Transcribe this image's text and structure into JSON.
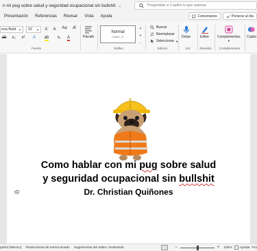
{
  "title_bar": {
    "doc_title": "n mi pug sobre salud y seguridad ocupacional sin bullshit",
    "search_placeholder": "Pregúntale a Copilot lo que quieras"
  },
  "tabs": [
    "Presentación",
    "Referencias",
    "Revisar",
    "Vista",
    "Ayuda"
  ],
  "tab_actions": {
    "comments": "Comentarios",
    "catch_up": "Ponerse al día"
  },
  "ribbon": {
    "font_name": "ova Bold",
    "font_size": "22",
    "groups": {
      "font": "Fuente",
      "paragraph": "Párrafo",
      "styles": "Estilos",
      "editing": "Edición",
      "voice": "Voz",
      "review": "Revisión",
      "addins": "Complementos"
    },
    "style_name": "Normal",
    "style_sub": "Calibri, 11",
    "edit": {
      "find": "Buscar",
      "replace": "Reemplazar",
      "select": "Seleccionar"
    },
    "dictate": "Dictar",
    "editor": "Editor",
    "addins_btn": "Complementos",
    "copilot": "Copilo"
  },
  "document": {
    "heading_line1_pre": "Como hablar con mi ",
    "heading_line1_mark": "pug",
    "heading_line1_post": " sobre salud",
    "heading_line2_pre": "y seguridad ocupacional sin ",
    "heading_line2_mark": "bullshit",
    "author": "Dr. Christian Quiñones"
  },
  "status_bar": {
    "language": "pañol (México)",
    "predictions": "Predicciones de textoActivado",
    "suggestions": "Sugerencias del editor: mostrando",
    "zoom": "100%",
    "fit": "Ajustar",
    "more": "Pro"
  },
  "colors": {
    "chrome": "#f3f3f3",
    "canvas": "#e6e6e6",
    "hardhat": "#f6c21c",
    "vest": "#f07a1a",
    "squiggle": "#d23b3b"
  },
  "zoom_level": 1.0
}
